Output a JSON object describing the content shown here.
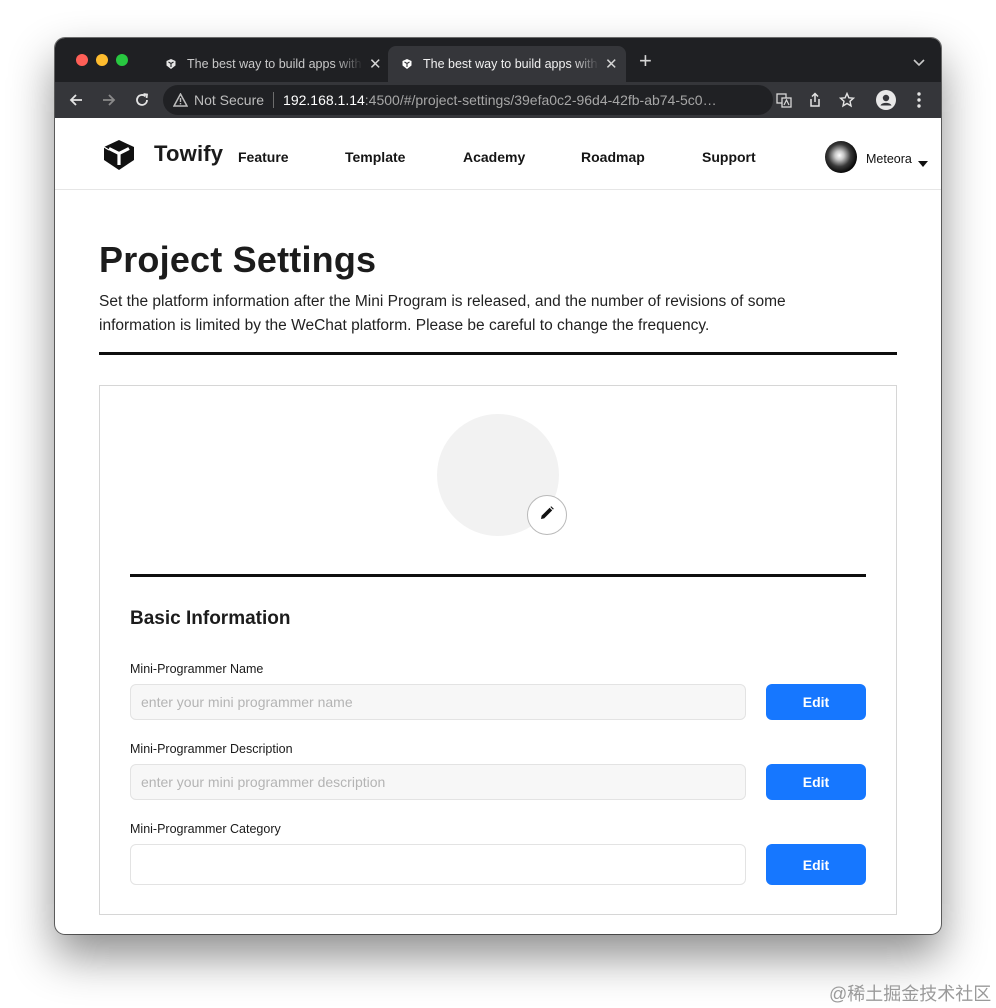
{
  "browser": {
    "tabs": [
      {
        "title": "The best way to build apps with Towify"
      },
      {
        "title": "The best way to build apps with Towify"
      }
    ],
    "new_tab_symbol": "+",
    "security_label": "Not Secure",
    "url_host": "192.168.1.14",
    "url_path": ":4500/#/project-settings/39efa0c2-96d4-42fb-ab74-5c0…"
  },
  "site": {
    "brand": "Towify",
    "nav": [
      {
        "label": "Feature"
      },
      {
        "label": "Template"
      },
      {
        "label": "Academy"
      },
      {
        "label": "Roadmap"
      },
      {
        "label": "Support"
      }
    ],
    "user": {
      "name": "Meteora"
    }
  },
  "page": {
    "title": "Project Settings",
    "description": "Set the platform information after the Mini Program is released, and the number of revisions of some information is limited by the WeChat platform. Please be careful to change the frequency."
  },
  "basic_info": {
    "title": "Basic Information",
    "fields": [
      {
        "label": "Mini-Programmer Name",
        "placeholder": "enter your mini programmer name",
        "value": "",
        "button": "Edit"
      },
      {
        "label": "Mini-Programmer Description",
        "placeholder": "enter your mini programmer description",
        "value": "",
        "button": "Edit"
      },
      {
        "label": "Mini-Programmer Category",
        "placeholder": "",
        "value": "",
        "button": "Edit"
      }
    ]
  },
  "watermark": "@稀土掘金技术社区",
  "colors": {
    "accent": "#1677ff",
    "titlebar": "#1f2023",
    "toolbar": "#35363a"
  },
  "icons": [
    "towify-logo-icon",
    "close-icon",
    "plus-icon",
    "chevron-down-icon",
    "back-arrow-icon",
    "forward-arrow-icon",
    "reload-icon",
    "warning-icon",
    "translate-icon",
    "share-icon",
    "star-icon",
    "profile-icon",
    "more-vert-icon",
    "pencil-icon",
    "caret-down-icon"
  ]
}
